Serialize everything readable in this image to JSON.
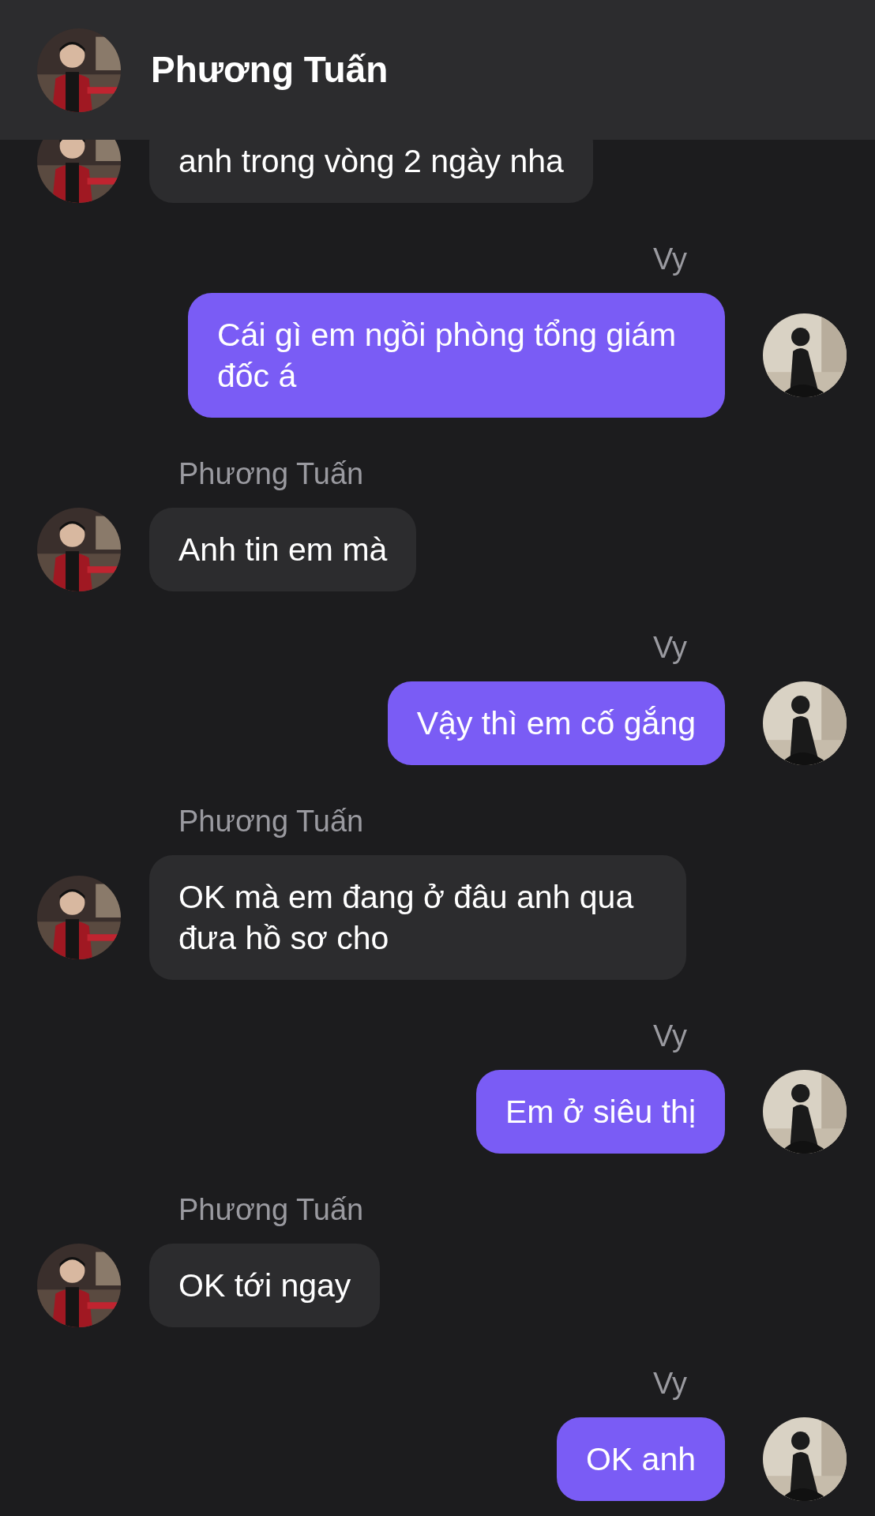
{
  "header": {
    "name": "Phương Tuấn"
  },
  "messages": [
    {
      "kind": "received",
      "text": "anh trong vòng 2 ngày nha"
    },
    {
      "kind": "sent",
      "sender": "Vy",
      "text": "Cái gì em ngồi phòng tổng giám đốc á"
    },
    {
      "kind": "received",
      "sender": "Phương Tuấn",
      "text": "Anh tin em mà"
    },
    {
      "kind": "sent",
      "sender": "Vy",
      "text": "Vậy thì em cố gắng"
    },
    {
      "kind": "received",
      "sender": "Phương Tuấn",
      "text": "OK mà em đang ở đâu anh qua đưa hồ sơ cho"
    },
    {
      "kind": "sent",
      "sender": "Vy",
      "text": "Em ở siêu thị"
    },
    {
      "kind": "received",
      "sender": "Phương Tuấn",
      "text": "OK tới ngay"
    },
    {
      "kind": "sent",
      "sender": "Vy",
      "text": "OK anh"
    }
  ]
}
